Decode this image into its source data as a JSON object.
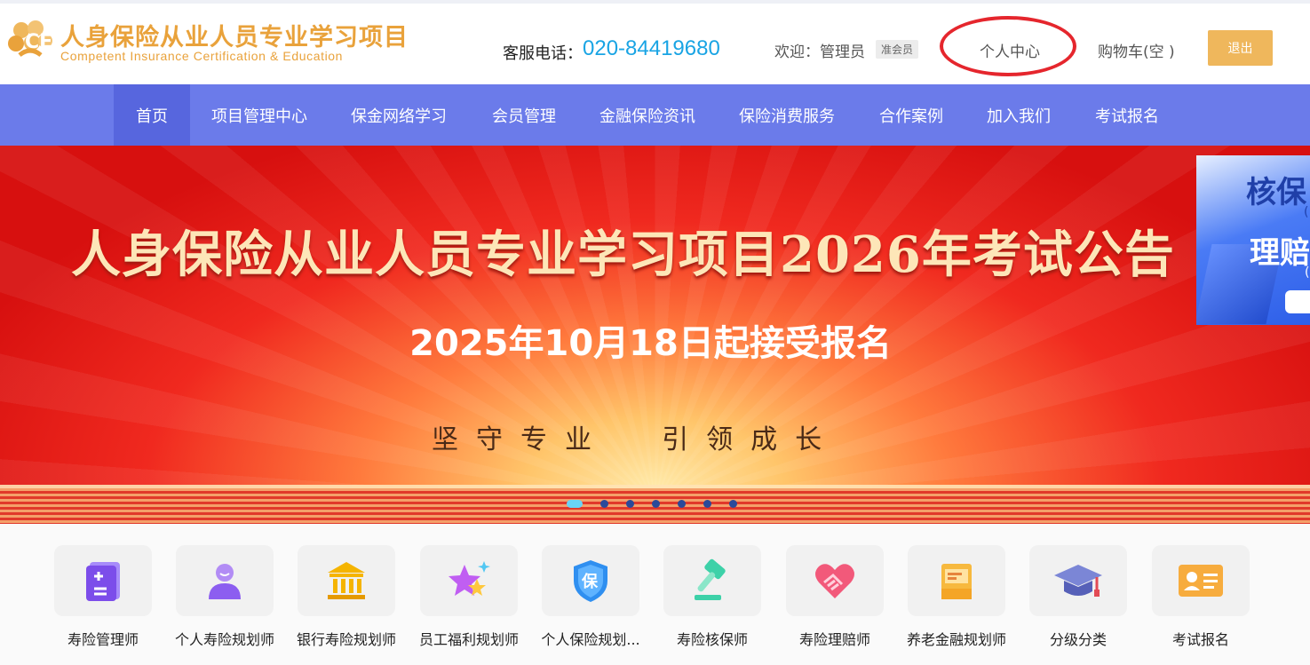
{
  "header": {
    "brand_cn": "人身保险从业人员专业学习项目",
    "brand_en": "Competent Insurance Certification & Education",
    "hotline_label": "客服电话：",
    "hotline_number": "020-84419680",
    "welcome_text": "欢迎：管理员",
    "member_badge": "准会员",
    "user_center": "个人中心",
    "cart": "购物车(空 )",
    "logout": "退出"
  },
  "nav": {
    "items": [
      {
        "label": "首页",
        "active": true
      },
      {
        "label": "项目管理中心"
      },
      {
        "label": "保金网络学习"
      },
      {
        "label": "会员管理"
      },
      {
        "label": "金融保险资讯"
      },
      {
        "label": "保险消费服务"
      },
      {
        "label": "合作案例"
      },
      {
        "label": "加入我们"
      },
      {
        "label": "考试报名"
      }
    ]
  },
  "banner": {
    "title": "人身保险从业人员专业学习项目2026年考试公告",
    "subtitle": "2025年10月18日起接受报名",
    "motto": "坚守专业  引领成长",
    "slide_count": 7,
    "active_slide": 1
  },
  "side_ad": {
    "line1": "核保",
    "line2": "理赔",
    "paren": "("
  },
  "categories": [
    {
      "label": "寿险管理师",
      "icon": "document-icon"
    },
    {
      "label": "个人寿险规划师",
      "icon": "person-icon"
    },
    {
      "label": "银行寿险规划师",
      "icon": "bank-icon"
    },
    {
      "label": "员工福利规划师",
      "icon": "stars-icon"
    },
    {
      "label": "个人保险规划...",
      "icon": "shield-icon"
    },
    {
      "label": "寿险核保师",
      "icon": "gavel-icon"
    },
    {
      "label": "寿险理赔师",
      "icon": "heart-hand-icon"
    },
    {
      "label": "养老金融规划师",
      "icon": "mailbox-icon"
    },
    {
      "label": "分级分类",
      "icon": "graduation-cap-icon"
    },
    {
      "label": "考试报名",
      "icon": "id-card-icon"
    }
  ],
  "colors": {
    "brand": "#e9a23b",
    "hotline": "#19a4e4",
    "nav_bg": "#6b7bea",
    "nav_active": "#5766de",
    "logout_bg": "#efb75c",
    "annotation_circle": "#e5262d"
  }
}
